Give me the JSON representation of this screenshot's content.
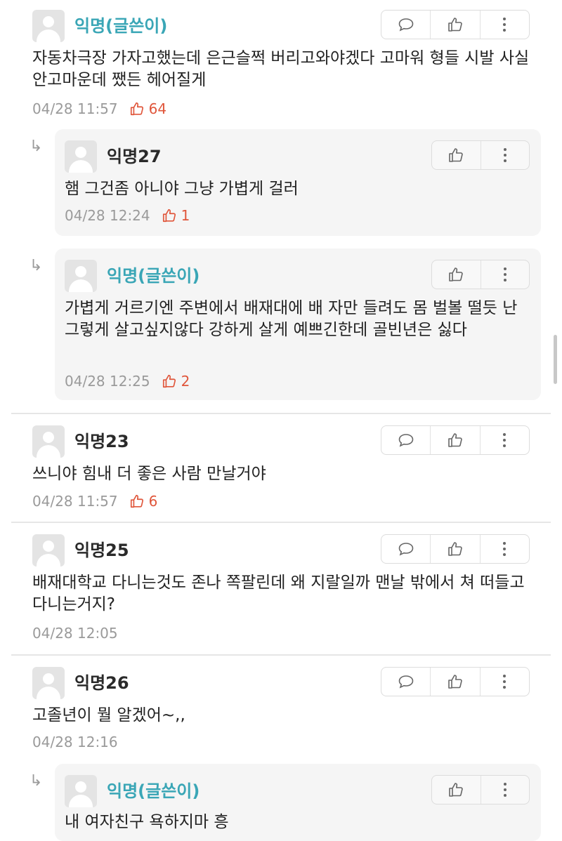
{
  "comments": [
    {
      "name": "익명(글쓴이)",
      "text": "자동차극장 가자고했는데 은근슬쩍 버리고와야겠다 고마워 형들 시발 사실 안고마운데 쨌든 헤어질게",
      "time": "04/28 11:57",
      "likes": "64",
      "replies": [
        {
          "name": "익명27",
          "text": "햄 그건좀 아니야 그냥 가볍게 걸러",
          "time": "04/28 12:24",
          "likes": "1"
        },
        {
          "name": "익명(글쓴이)",
          "text": "가볍게 거르기엔 주변에서 배재대에 배 자만 들려도 몸 벌볼 떨듯 난 그렇게 살고싶지않다 강하게 살게 예쁘긴한데 골빈년은 싫다",
          "time": "04/28 12:25",
          "likes": "2"
        }
      ]
    },
    {
      "name": "익명23",
      "text": "쓰니야 힘내 더 좋은 사람 만날거야",
      "time": "04/28 11:57",
      "likes": "6"
    },
    {
      "name": "익명25",
      "text": "배재대학교 다니는것도 존나 쪽팔린데 왜 지랄일까 맨날 밖에서 쳐 떠들고 다니는거지?",
      "time": "04/28 12:05"
    },
    {
      "name": "익명26",
      "text": "고졸년이 뭘 알겠어~,,",
      "time": "04/28 12:16",
      "replies": [
        {
          "name": "익명(글쓴이)",
          "text": "내 여자친구 욕하지마 흥"
        }
      ]
    }
  ],
  "reply_arrow": "↳",
  "icons": {
    "reply": "speech-bubble-icon",
    "like": "thumbs-up-icon",
    "more": "more-vertical-icon"
  },
  "colors": {
    "writer": "#3aa6b6",
    "likes": "#e0563b",
    "meta": "#9a9a9a"
  }
}
